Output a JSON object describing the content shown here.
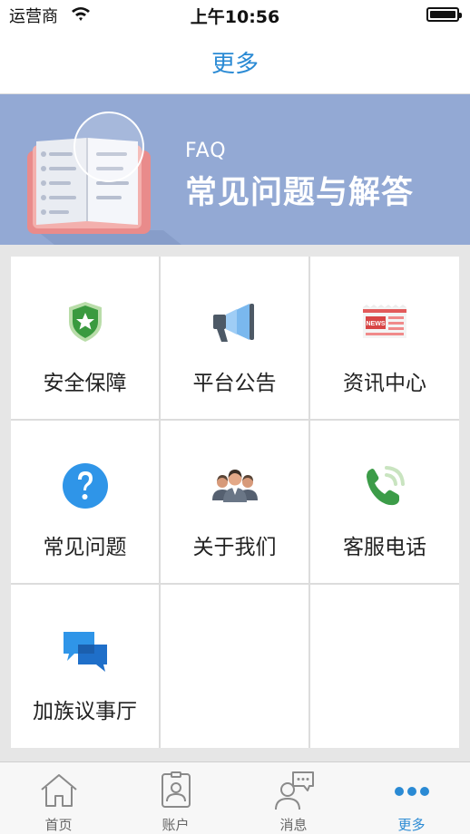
{
  "status_bar": {
    "carrier": "运营商",
    "time": "上午10:56"
  },
  "nav": {
    "title": "更多"
  },
  "banner": {
    "label": "FAQ",
    "title": "常见问题与解答"
  },
  "grid": [
    {
      "label": "安全保障",
      "icon": "shield-star-icon"
    },
    {
      "label": "平台公告",
      "icon": "megaphone-icon"
    },
    {
      "label": "资讯中心",
      "icon": "news-icon"
    },
    {
      "label": "常见问题",
      "icon": "question-icon"
    },
    {
      "label": "关于我们",
      "icon": "team-icon"
    },
    {
      "label": "客服电话",
      "icon": "phone-icon"
    },
    {
      "label": "加族议事厅",
      "icon": "chat-bubbles-icon"
    }
  ],
  "tabs": [
    {
      "label": "首页",
      "icon": "home-icon"
    },
    {
      "label": "账户",
      "icon": "account-icon"
    },
    {
      "label": "消息",
      "icon": "message-icon"
    },
    {
      "label": "更多",
      "icon": "more-icon",
      "active": true
    }
  ],
  "colors": {
    "accent": "#2a8ad4",
    "banner": "#93a9d4",
    "shield": "#3a9a3f",
    "phone": "#3c9c48",
    "question": "#2f95e8"
  }
}
